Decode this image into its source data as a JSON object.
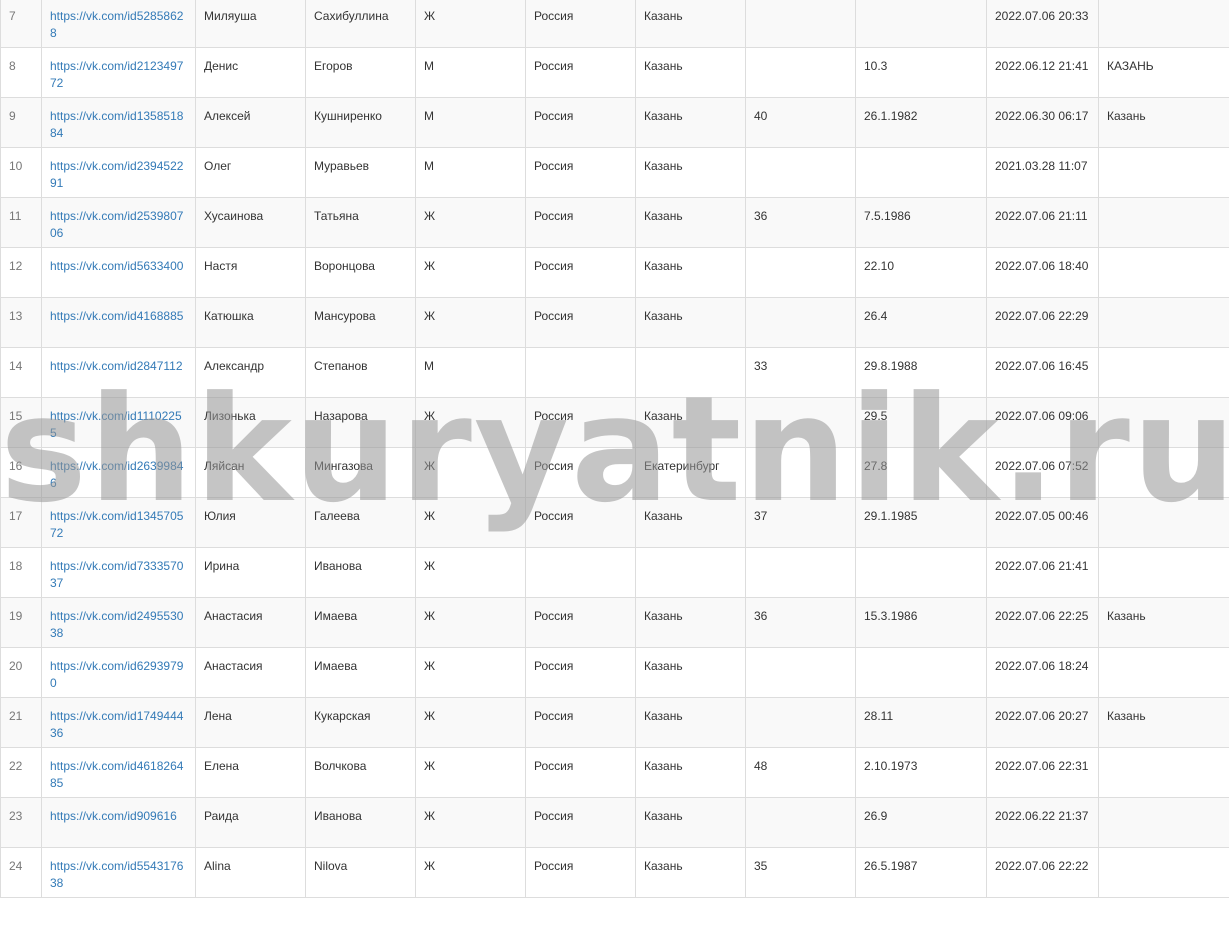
{
  "watermark": "shkuryatnik.ru",
  "rows": [
    {
      "num": "7",
      "link": "https://vk.com/id52858628",
      "first": "Миляуша",
      "last": "Сахибуллина",
      "sex": "Ж",
      "country": "Россия",
      "city": "Казань",
      "age": "",
      "birthday": "",
      "last_seen": "2022.07.06 20:33",
      "hometown": ""
    },
    {
      "num": "8",
      "link": "https://vk.com/id212349772",
      "first": "Денис",
      "last": "Егоров",
      "sex": "М",
      "country": "Россия",
      "city": "Казань",
      "age": "",
      "birthday": "10.3",
      "last_seen": "2022.06.12 21:41",
      "hometown": "КАЗАНЬ"
    },
    {
      "num": "9",
      "link": "https://vk.com/id135851884",
      "first": "Алексей",
      "last": "Кушниренко",
      "sex": "М",
      "country": "Россия",
      "city": "Казань",
      "age": "40",
      "birthday": "26.1.1982",
      "last_seen": "2022.06.30 06:17",
      "hometown": "Казань"
    },
    {
      "num": "10",
      "link": "https://vk.com/id239452291",
      "first": "Олег",
      "last": "Муравьев",
      "sex": "М",
      "country": "Россия",
      "city": "Казань",
      "age": "",
      "birthday": "",
      "last_seen": "2021.03.28 11:07",
      "hometown": ""
    },
    {
      "num": "11",
      "link": "https://vk.com/id253980706",
      "first": "Хусаинова",
      "last": "Татьяна",
      "sex": "Ж",
      "country": "Россия",
      "city": "Казань",
      "age": "36",
      "birthday": "7.5.1986",
      "last_seen": "2022.07.06 21:11",
      "hometown": ""
    },
    {
      "num": "12",
      "link": "https://vk.com/id5633400",
      "first": "Настя",
      "last": "Воронцова",
      "sex": "Ж",
      "country": "Россия",
      "city": "Казань",
      "age": "",
      "birthday": "22.10",
      "last_seen": "2022.07.06 18:40",
      "hometown": ""
    },
    {
      "num": "13",
      "link": "https://vk.com/id4168885",
      "first": "Катюшка",
      "last": "Мансурова",
      "sex": "Ж",
      "country": "Россия",
      "city": "Казань",
      "age": "",
      "birthday": "26.4",
      "last_seen": "2022.07.06 22:29",
      "hometown": ""
    },
    {
      "num": "14",
      "link": "https://vk.com/id2847112",
      "first": "Александр",
      "last": "Степанов",
      "sex": "М",
      "country": "",
      "city": "",
      "age": "33",
      "birthday": "29.8.1988",
      "last_seen": "2022.07.06 16:45",
      "hometown": ""
    },
    {
      "num": "15",
      "link": "https://vk.com/id11102255",
      "first": "Лизонька",
      "last": "Назарова",
      "sex": "Ж",
      "country": "Россия",
      "city": "Казань",
      "age": "",
      "birthday": "29.5",
      "last_seen": "2022.07.06 09:06",
      "hometown": ""
    },
    {
      "num": "16",
      "link": "https://vk.com/id26399846",
      "first": "Ляйсан",
      "last": "Мингазова",
      "sex": "Ж",
      "country": "Россия",
      "city": "Екатеринбург",
      "age": "",
      "birthday": "27.8",
      "last_seen": "2022.07.06 07:52",
      "hometown": ""
    },
    {
      "num": "17",
      "link": "https://vk.com/id134570572",
      "first": "Юлия",
      "last": "Галеева",
      "sex": "Ж",
      "country": "Россия",
      "city": "Казань",
      "age": "37",
      "birthday": "29.1.1985",
      "last_seen": "2022.07.05 00:46",
      "hometown": ""
    },
    {
      "num": "18",
      "link": "https://vk.com/id733357037",
      "first": "Ирина",
      "last": "Иванова",
      "sex": "Ж",
      "country": "",
      "city": "",
      "age": "",
      "birthday": "",
      "last_seen": "2022.07.06 21:41",
      "hometown": ""
    },
    {
      "num": "19",
      "link": "https://vk.com/id249553038",
      "first": "Анастасия",
      "last": "Имаева",
      "sex": "Ж",
      "country": "Россия",
      "city": "Казань",
      "age": "36",
      "birthday": "15.3.1986",
      "last_seen": "2022.07.06 22:25",
      "hometown": "Казань"
    },
    {
      "num": "20",
      "link": "https://vk.com/id62939790",
      "first": "Анастасия",
      "last": "Имаева",
      "sex": "Ж",
      "country": "Россия",
      "city": "Казань",
      "age": "",
      "birthday": "",
      "last_seen": "2022.07.06 18:24",
      "hometown": ""
    },
    {
      "num": "21",
      "link": "https://vk.com/id174944436",
      "first": "Лена",
      "last": "Кукарская",
      "sex": "Ж",
      "country": "Россия",
      "city": "Казань",
      "age": "",
      "birthday": "28.11",
      "last_seen": "2022.07.06 20:27",
      "hometown": "Казань"
    },
    {
      "num": "22",
      "link": "https://vk.com/id461826485",
      "first": "Елена",
      "last": "Волчкова",
      "sex": "Ж",
      "country": "Россия",
      "city": "Казань",
      "age": "48",
      "birthday": "2.10.1973",
      "last_seen": "2022.07.06 22:31",
      "hometown": ""
    },
    {
      "num": "23",
      "link": "https://vk.com/id909616",
      "first": "Раида",
      "last": "Иванова",
      "sex": "Ж",
      "country": "Россия",
      "city": "Казань",
      "age": "",
      "birthday": "26.9",
      "last_seen": "2022.06.22 21:37",
      "hometown": ""
    },
    {
      "num": "24",
      "link": "https://vk.com/id554317638",
      "first": "Alina",
      "last": "Nilova",
      "sex": "Ж",
      "country": "Россия",
      "city": "Казань",
      "age": "35",
      "birthday": "26.5.1987",
      "last_seen": "2022.07.06 22:22",
      "hometown": ""
    }
  ]
}
